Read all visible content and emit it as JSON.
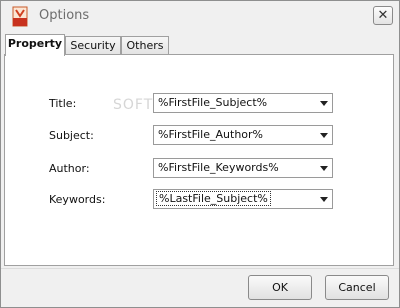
{
  "window": {
    "title": "Options",
    "close_label": "✕"
  },
  "tabs": [
    {
      "label": "Property",
      "active": true
    },
    {
      "label": "Security",
      "active": false
    },
    {
      "label": "Others",
      "active": false
    }
  ],
  "fields": [
    {
      "label": "Title:",
      "value": "%FirstFile_Subject%"
    },
    {
      "label": "Subject:",
      "value": "%FirstFile_Author%"
    },
    {
      "label": "Author:",
      "value": "%FirstFile_Keywords%"
    },
    {
      "label": "Keywords:",
      "value": "%LastFile_Subject%"
    }
  ],
  "watermark": "SOFTPEDIA",
  "buttons": {
    "ok": "OK",
    "cancel": "Cancel"
  },
  "colors": {
    "window_bg": "#f0f0f0",
    "panel_bg": "#ffffff",
    "border": "#a0a0a0"
  }
}
